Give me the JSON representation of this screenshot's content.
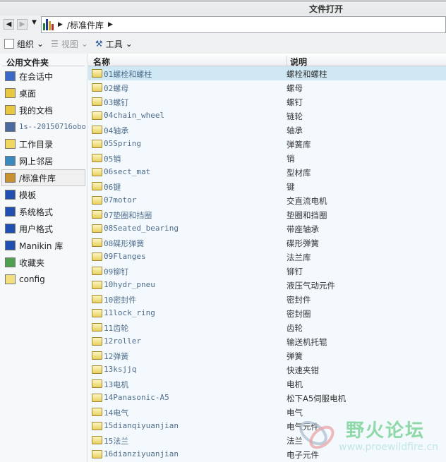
{
  "window": {
    "title": "文件打开"
  },
  "address": {
    "path": "/标准件库"
  },
  "toolbar": {
    "organize": "组织",
    "view": "视图",
    "tools": "工具"
  },
  "sidebar": {
    "header": "公用文件夹",
    "items": [
      {
        "label": "在会话中",
        "icon": "session-icon"
      },
      {
        "label": "桌面",
        "icon": "desktop-icon"
      },
      {
        "label": "我的文档",
        "icon": "documents-icon"
      },
      {
        "label": "1s--20150716obo",
        "icon": "computer-icon"
      },
      {
        "label": "工作目录",
        "icon": "working-dir-icon"
      },
      {
        "label": "网上邻居",
        "icon": "network-icon"
      },
      {
        "label": "/标准件库",
        "icon": "library-icon"
      },
      {
        "label": "模板",
        "icon": "template-folder-icon"
      },
      {
        "label": "系统格式",
        "icon": "system-format-folder-icon"
      },
      {
        "label": "用户格式",
        "icon": "user-format-folder-icon"
      },
      {
        "label": "Manikin 库",
        "icon": "manikin-folder-icon"
      },
      {
        "label": "收藏夹",
        "icon": "favorites-icon"
      },
      {
        "label": "config",
        "icon": "folder-icon"
      }
    ]
  },
  "columns": {
    "name": "名称",
    "desc": "说明"
  },
  "files": [
    {
      "name": "01螺栓和螺柱",
      "desc": "螺栓和螺柱"
    },
    {
      "name": "02螺母",
      "desc": "螺母"
    },
    {
      "name": "03螺钉",
      "desc": "螺钉"
    },
    {
      "name": "04chain_wheel",
      "desc": "链轮"
    },
    {
      "name": "04轴承",
      "desc": "轴承"
    },
    {
      "name": "05Spring",
      "desc": "弹簧库"
    },
    {
      "name": "05销",
      "desc": "销"
    },
    {
      "name": "06sect_mat",
      "desc": "型材库"
    },
    {
      "name": "06键",
      "desc": "键"
    },
    {
      "name": "07motor",
      "desc": "交直流电机"
    },
    {
      "name": "07垫圈和挡圈",
      "desc": "垫圈和挡圈"
    },
    {
      "name": "08Seated_bearing",
      "desc": "带座轴承"
    },
    {
      "name": "08碟形弹簧",
      "desc": "碟形弹簧"
    },
    {
      "name": "09Flanges",
      "desc": "法兰库"
    },
    {
      "name": "09铆钉",
      "desc": "铆钉"
    },
    {
      "name": "10hydr_pneu",
      "desc": "液压气动元件"
    },
    {
      "name": "10密封件",
      "desc": "密封件"
    },
    {
      "name": "11lock_ring",
      "desc": "密封圈"
    },
    {
      "name": "11齿轮",
      "desc": "齿轮"
    },
    {
      "name": "12roller",
      "desc": "输送机托辊"
    },
    {
      "name": "12弹簧",
      "desc": "弹簧"
    },
    {
      "name": "13ksjjq",
      "desc": "快速夹钳"
    },
    {
      "name": "13电机",
      "desc": "电机"
    },
    {
      "name": "14Panasonic-A5",
      "desc": "松下A5伺服电机"
    },
    {
      "name": "14电气",
      "desc": "电气"
    },
    {
      "name": "15dianqiyuanjian",
      "desc": "电气元件"
    },
    {
      "name": "15法兰",
      "desc": "法兰"
    },
    {
      "name": "16dianziyuanjian",
      "desc": "电子元件"
    }
  ],
  "watermark": {
    "title": "野火论坛",
    "url": "www.proewildfire.cn"
  }
}
